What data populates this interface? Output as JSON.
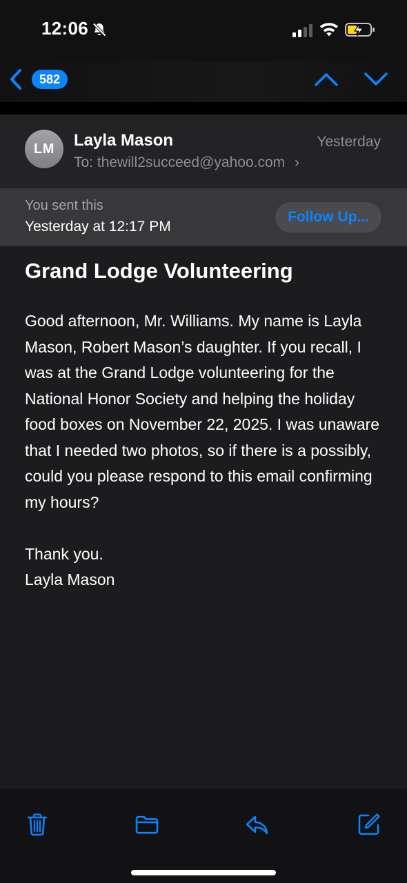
{
  "status_bar": {
    "time": "12:06",
    "icons": [
      "bell-slash-icon",
      "cellular-signal-icon",
      "wifi-icon",
      "battery-charging-icon"
    ]
  },
  "nav": {
    "back_icon": "chevron-left-icon",
    "unread_count": "582",
    "prev_icon": "chevron-up-icon",
    "next_icon": "chevron-down-icon"
  },
  "header": {
    "avatar_initials": "LM",
    "sender": "Layla Mason",
    "to_label": "To:",
    "to_address": "thewill2succeed@yahoo.com",
    "to_chevron": "›",
    "date": "Yesterday"
  },
  "sent_banner": {
    "line1": "You sent this",
    "line2": "Yesterday at 12:17 PM",
    "follow_up_label": "Follow Up..."
  },
  "email": {
    "subject": "Grand Lodge Volunteering",
    "paragraph1": "Good afternoon, Mr. Williams. My name is Layla Mason, Robert Mason’s daughter. If you recall, I was at the Grand Lodge volunteering for the National Honor Society and helping the holiday food boxes on November 22, 2025. I was unaware that I needed two photos, so if there is a possibly, could you please respond to this email confirming my hours?",
    "closing": "Thank you.",
    "signature": "Layla Mason"
  },
  "toolbar": {
    "icons": [
      "trash-icon",
      "folder-icon",
      "reply-icon",
      "compose-icon"
    ]
  },
  "colors": {
    "accent": "#0a84ff",
    "header_bg": "#232325",
    "banner_bg": "#38383a",
    "body_bg": "#1c1c1e"
  }
}
